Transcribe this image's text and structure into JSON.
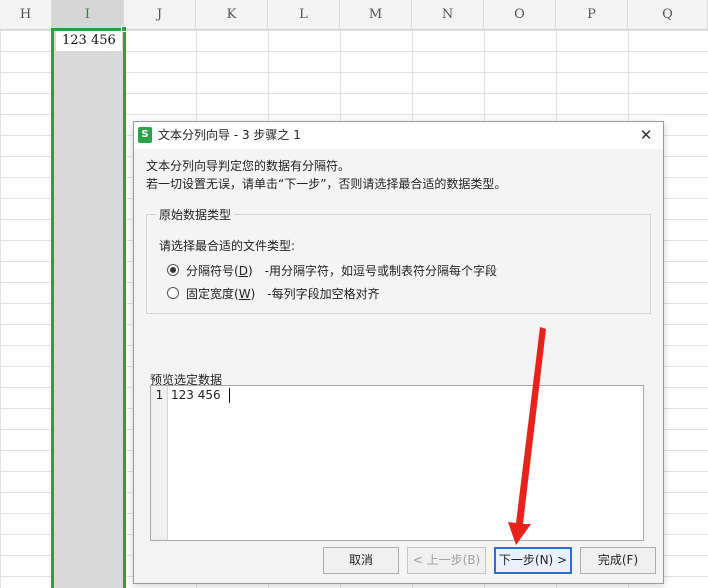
{
  "spreadsheet": {
    "columns": [
      "H",
      "I",
      "J",
      "K",
      "L",
      "M",
      "N",
      "O",
      "P",
      "Q"
    ],
    "selected_column": "I",
    "cell_i1": "123 456"
  },
  "dialog": {
    "title": "文本分列向导 - 3 步骤之 1",
    "app_icon_letter": "S",
    "close_glyph": "✕",
    "intro_line1": "文本分列向导判定您的数据有分隔符。",
    "intro_line2": "若一切设置无误，请单击“下一步”，否则请选择最合适的数据类型。",
    "original_group": {
      "legend": "原始数据类型",
      "prompt": "请选择最合适的文件类型:",
      "options": [
        {
          "label_pre": "分隔符号(",
          "hotkey": "D",
          "label_post": ")",
          "description": "-用分隔字符，如逗号或制表符分隔每个字段",
          "checked": true
        },
        {
          "label_pre": "固定宽度(",
          "hotkey": "W",
          "label_post": ")",
          "description": "-每列字段加空格对齐",
          "checked": false
        }
      ]
    },
    "preview": {
      "legend": "预览选定数据",
      "row_number": "1",
      "row_text": "123 456"
    },
    "buttons": {
      "cancel": "取消",
      "back": "< 上一步(B)",
      "next": "下一步(N) >",
      "finish": "完成(F)"
    }
  },
  "annotation": {
    "arrow_color": "#e8231b"
  }
}
